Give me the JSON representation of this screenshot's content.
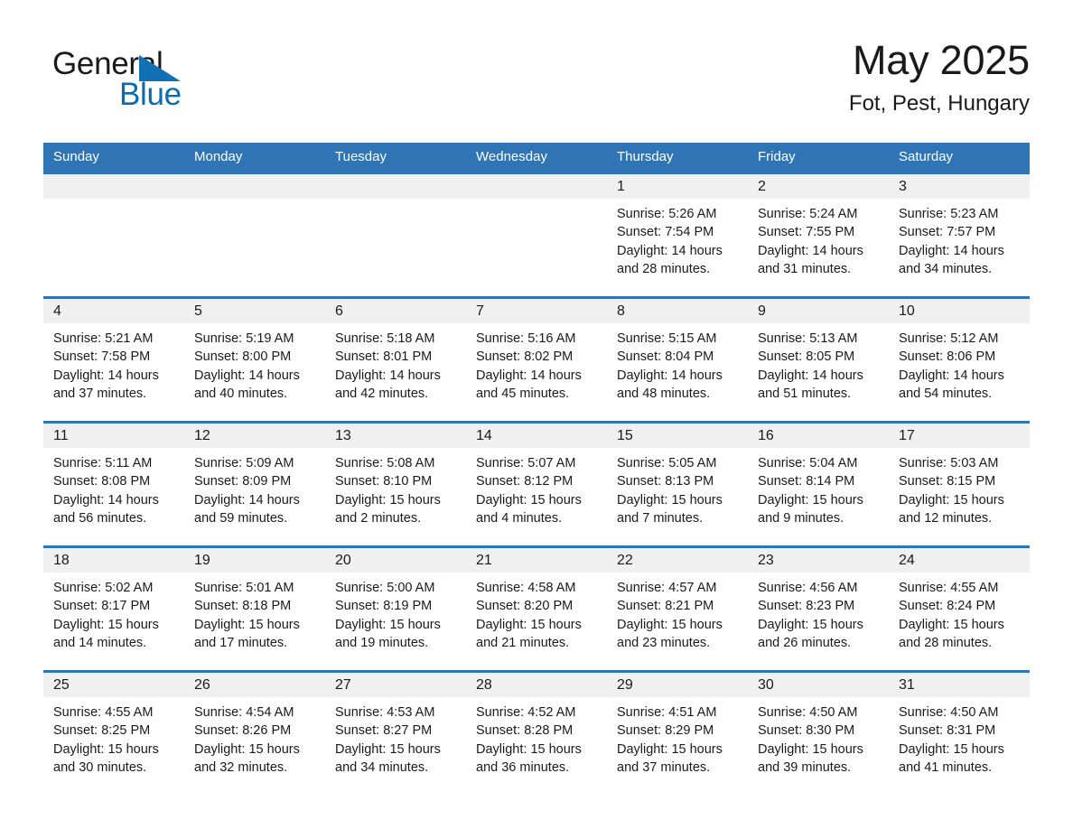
{
  "brand": {
    "name_top": "General",
    "name_bottom": "Blue",
    "triangle_color": "#1271b5",
    "blue_color": "#0d6cb0"
  },
  "header": {
    "month_year": "May 2025",
    "location": "Fot, Pest, Hungary"
  },
  "theme": {
    "header_blue": "#2f75b5",
    "daynum_band": "#f0f0f0",
    "divider_blue": "#2f75b5"
  },
  "weekday_headers": [
    "Sunday",
    "Monday",
    "Tuesday",
    "Wednesday",
    "Thursday",
    "Friday",
    "Saturday"
  ],
  "weeks": [
    [
      {
        "day": "",
        "blank": true,
        "lines": []
      },
      {
        "day": "",
        "blank": true,
        "lines": []
      },
      {
        "day": "",
        "blank": true,
        "lines": []
      },
      {
        "day": "",
        "blank": true,
        "lines": []
      },
      {
        "day": "1",
        "blank": false,
        "lines": [
          "Sunrise: 5:26 AM",
          "Sunset: 7:54 PM",
          "Daylight: 14 hours",
          "and 28 minutes."
        ]
      },
      {
        "day": "2",
        "blank": false,
        "lines": [
          "Sunrise: 5:24 AM",
          "Sunset: 7:55 PM",
          "Daylight: 14 hours",
          "and 31 minutes."
        ]
      },
      {
        "day": "3",
        "blank": false,
        "lines": [
          "Sunrise: 5:23 AM",
          "Sunset: 7:57 PM",
          "Daylight: 14 hours",
          "and 34 minutes."
        ]
      }
    ],
    [
      {
        "day": "4",
        "blank": false,
        "lines": [
          "Sunrise: 5:21 AM",
          "Sunset: 7:58 PM",
          "Daylight: 14 hours",
          "and 37 minutes."
        ]
      },
      {
        "day": "5",
        "blank": false,
        "lines": [
          "Sunrise: 5:19 AM",
          "Sunset: 8:00 PM",
          "Daylight: 14 hours",
          "and 40 minutes."
        ]
      },
      {
        "day": "6",
        "blank": false,
        "lines": [
          "Sunrise: 5:18 AM",
          "Sunset: 8:01 PM",
          "Daylight: 14 hours",
          "and 42 minutes."
        ]
      },
      {
        "day": "7",
        "blank": false,
        "lines": [
          "Sunrise: 5:16 AM",
          "Sunset: 8:02 PM",
          "Daylight: 14 hours",
          "and 45 minutes."
        ]
      },
      {
        "day": "8",
        "blank": false,
        "lines": [
          "Sunrise: 5:15 AM",
          "Sunset: 8:04 PM",
          "Daylight: 14 hours",
          "and 48 minutes."
        ]
      },
      {
        "day": "9",
        "blank": false,
        "lines": [
          "Sunrise: 5:13 AM",
          "Sunset: 8:05 PM",
          "Daylight: 14 hours",
          "and 51 minutes."
        ]
      },
      {
        "day": "10",
        "blank": false,
        "lines": [
          "Sunrise: 5:12 AM",
          "Sunset: 8:06 PM",
          "Daylight: 14 hours",
          "and 54 minutes."
        ]
      }
    ],
    [
      {
        "day": "11",
        "blank": false,
        "lines": [
          "Sunrise: 5:11 AM",
          "Sunset: 8:08 PM",
          "Daylight: 14 hours",
          "and 56 minutes."
        ]
      },
      {
        "day": "12",
        "blank": false,
        "lines": [
          "Sunrise: 5:09 AM",
          "Sunset: 8:09 PM",
          "Daylight: 14 hours",
          "and 59 minutes."
        ]
      },
      {
        "day": "13",
        "blank": false,
        "lines": [
          "Sunrise: 5:08 AM",
          "Sunset: 8:10 PM",
          "Daylight: 15 hours",
          "and 2 minutes."
        ]
      },
      {
        "day": "14",
        "blank": false,
        "lines": [
          "Sunrise: 5:07 AM",
          "Sunset: 8:12 PM",
          "Daylight: 15 hours",
          "and 4 minutes."
        ]
      },
      {
        "day": "15",
        "blank": false,
        "lines": [
          "Sunrise: 5:05 AM",
          "Sunset: 8:13 PM",
          "Daylight: 15 hours",
          "and 7 minutes."
        ]
      },
      {
        "day": "16",
        "blank": false,
        "lines": [
          "Sunrise: 5:04 AM",
          "Sunset: 8:14 PM",
          "Daylight: 15 hours",
          "and 9 minutes."
        ]
      },
      {
        "day": "17",
        "blank": false,
        "lines": [
          "Sunrise: 5:03 AM",
          "Sunset: 8:15 PM",
          "Daylight: 15 hours",
          "and 12 minutes."
        ]
      }
    ],
    [
      {
        "day": "18",
        "blank": false,
        "lines": [
          "Sunrise: 5:02 AM",
          "Sunset: 8:17 PM",
          "Daylight: 15 hours",
          "and 14 minutes."
        ]
      },
      {
        "day": "19",
        "blank": false,
        "lines": [
          "Sunrise: 5:01 AM",
          "Sunset: 8:18 PM",
          "Daylight: 15 hours",
          "and 17 minutes."
        ]
      },
      {
        "day": "20",
        "blank": false,
        "lines": [
          "Sunrise: 5:00 AM",
          "Sunset: 8:19 PM",
          "Daylight: 15 hours",
          "and 19 minutes."
        ]
      },
      {
        "day": "21",
        "blank": false,
        "lines": [
          "Sunrise: 4:58 AM",
          "Sunset: 8:20 PM",
          "Daylight: 15 hours",
          "and 21 minutes."
        ]
      },
      {
        "day": "22",
        "blank": false,
        "lines": [
          "Sunrise: 4:57 AM",
          "Sunset: 8:21 PM",
          "Daylight: 15 hours",
          "and 23 minutes."
        ]
      },
      {
        "day": "23",
        "blank": false,
        "lines": [
          "Sunrise: 4:56 AM",
          "Sunset: 8:23 PM",
          "Daylight: 15 hours",
          "and 26 minutes."
        ]
      },
      {
        "day": "24",
        "blank": false,
        "lines": [
          "Sunrise: 4:55 AM",
          "Sunset: 8:24 PM",
          "Daylight: 15 hours",
          "and 28 minutes."
        ]
      }
    ],
    [
      {
        "day": "25",
        "blank": false,
        "lines": [
          "Sunrise: 4:55 AM",
          "Sunset: 8:25 PM",
          "Daylight: 15 hours",
          "and 30 minutes."
        ]
      },
      {
        "day": "26",
        "blank": false,
        "lines": [
          "Sunrise: 4:54 AM",
          "Sunset: 8:26 PM",
          "Daylight: 15 hours",
          "and 32 minutes."
        ]
      },
      {
        "day": "27",
        "blank": false,
        "lines": [
          "Sunrise: 4:53 AM",
          "Sunset: 8:27 PM",
          "Daylight: 15 hours",
          "and 34 minutes."
        ]
      },
      {
        "day": "28",
        "blank": false,
        "lines": [
          "Sunrise: 4:52 AM",
          "Sunset: 8:28 PM",
          "Daylight: 15 hours",
          "and 36 minutes."
        ]
      },
      {
        "day": "29",
        "blank": false,
        "lines": [
          "Sunrise: 4:51 AM",
          "Sunset: 8:29 PM",
          "Daylight: 15 hours",
          "and 37 minutes."
        ]
      },
      {
        "day": "30",
        "blank": false,
        "lines": [
          "Sunrise: 4:50 AM",
          "Sunset: 8:30 PM",
          "Daylight: 15 hours",
          "and 39 minutes."
        ]
      },
      {
        "day": "31",
        "blank": false,
        "lines": [
          "Sunrise: 4:50 AM",
          "Sunset: 8:31 PM",
          "Daylight: 15 hours",
          "and 41 minutes."
        ]
      }
    ]
  ]
}
